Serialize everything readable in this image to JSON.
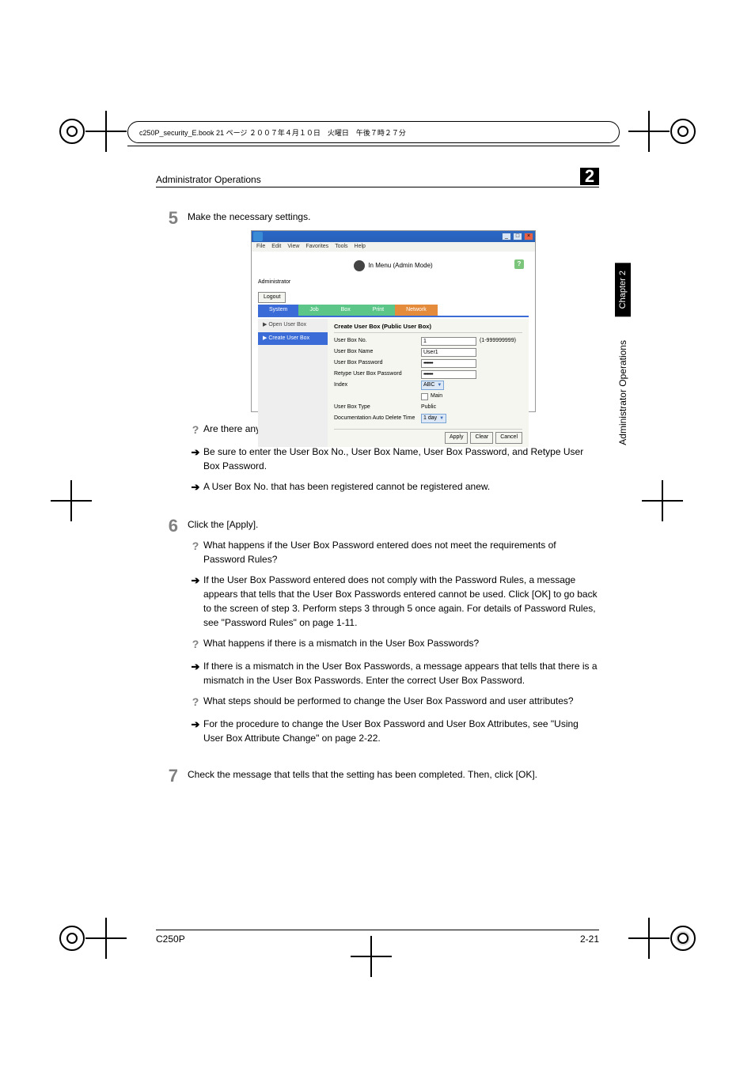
{
  "frame_header": "c250P_security_E.book  21 ページ  ２００７年４月１０日　火曜日　午後７時２７分",
  "header_title": "Administrator Operations",
  "chapter_number": "2",
  "side_tab": "Chapter 2",
  "side_text": "Administrator Operations",
  "step5": {
    "num": "5",
    "text": "Make the necessary settings."
  },
  "screenshot": {
    "menu": {
      "file": "File",
      "edit": "Edit",
      "view": "View",
      "favorites": "Favorites",
      "tools": "Tools",
      "help": "Help"
    },
    "mode_header": "In Menu (Admin Mode)",
    "help": "?",
    "administrator": "Administrator",
    "logout": "Logout",
    "tabs": {
      "system": "System",
      "job": "Job",
      "box": "Box",
      "print": "Print",
      "network": "Network"
    },
    "left": {
      "open": "▶ Open User Box",
      "create": "▶ Create User Box"
    },
    "form_title": "Create User Box (Public User Box)",
    "labels": {
      "no": "User Box No.",
      "name": "User Box Name",
      "pw": "User Box Password",
      "repw": "Retype User Box Password",
      "index": "Index",
      "main": "Main",
      "type": "User Box Type",
      "autodel": "Documentation Auto Delete Time"
    },
    "values": {
      "no": "1",
      "no_range": "(1-999999999)",
      "name": "User1",
      "pw": "••••••••",
      "repw": "••••••••",
      "index": "ABC",
      "type": "Public",
      "autodel": "1 day"
    },
    "buttons": {
      "apply": "Apply",
      "clear": "Clear",
      "cancel": "Cancel"
    }
  },
  "q5a": {
    "q": "Are there any precautions to be used when making settings?",
    "a1": "Be sure to enter the User Box No., User Box Name, User Box Password, and Retype User Box Password.",
    "a2": "A User Box No. that has been registered cannot be registered anew."
  },
  "step6": {
    "num": "6",
    "text": "Click the [Apply]."
  },
  "q6a": {
    "q": "What happens if the User Box Password entered does not meet the requirements of Password Rules?",
    "a": "If the User Box Password entered does not comply with the Password Rules, a message appears that tells that the User Box Passwords entered cannot be used. Click [OK] to go back to the screen of step 3. Perform steps 3 through 5 once again. For details of Password Rules, see \"Password Rules\" on page 1-11."
  },
  "q6b": {
    "q": "What happens if there is a mismatch in the User Box Passwords?",
    "a": "If there is a mismatch in the User Box Passwords, a message appears that tells that there is a mismatch in the User Box Passwords. Enter the correct User Box Password."
  },
  "q6c": {
    "q": "What steps should be performed to change the User Box Password and user attributes?",
    "a": "For the procedure to change the User Box Password and User Box Attributes, see \"Using User Box Attribute Change\" on page 2-22."
  },
  "step7": {
    "num": "7",
    "text": "Check the message that tells that the setting has been completed. Then, click [OK]."
  },
  "footer": {
    "left": "C250P",
    "right": "2-21"
  }
}
